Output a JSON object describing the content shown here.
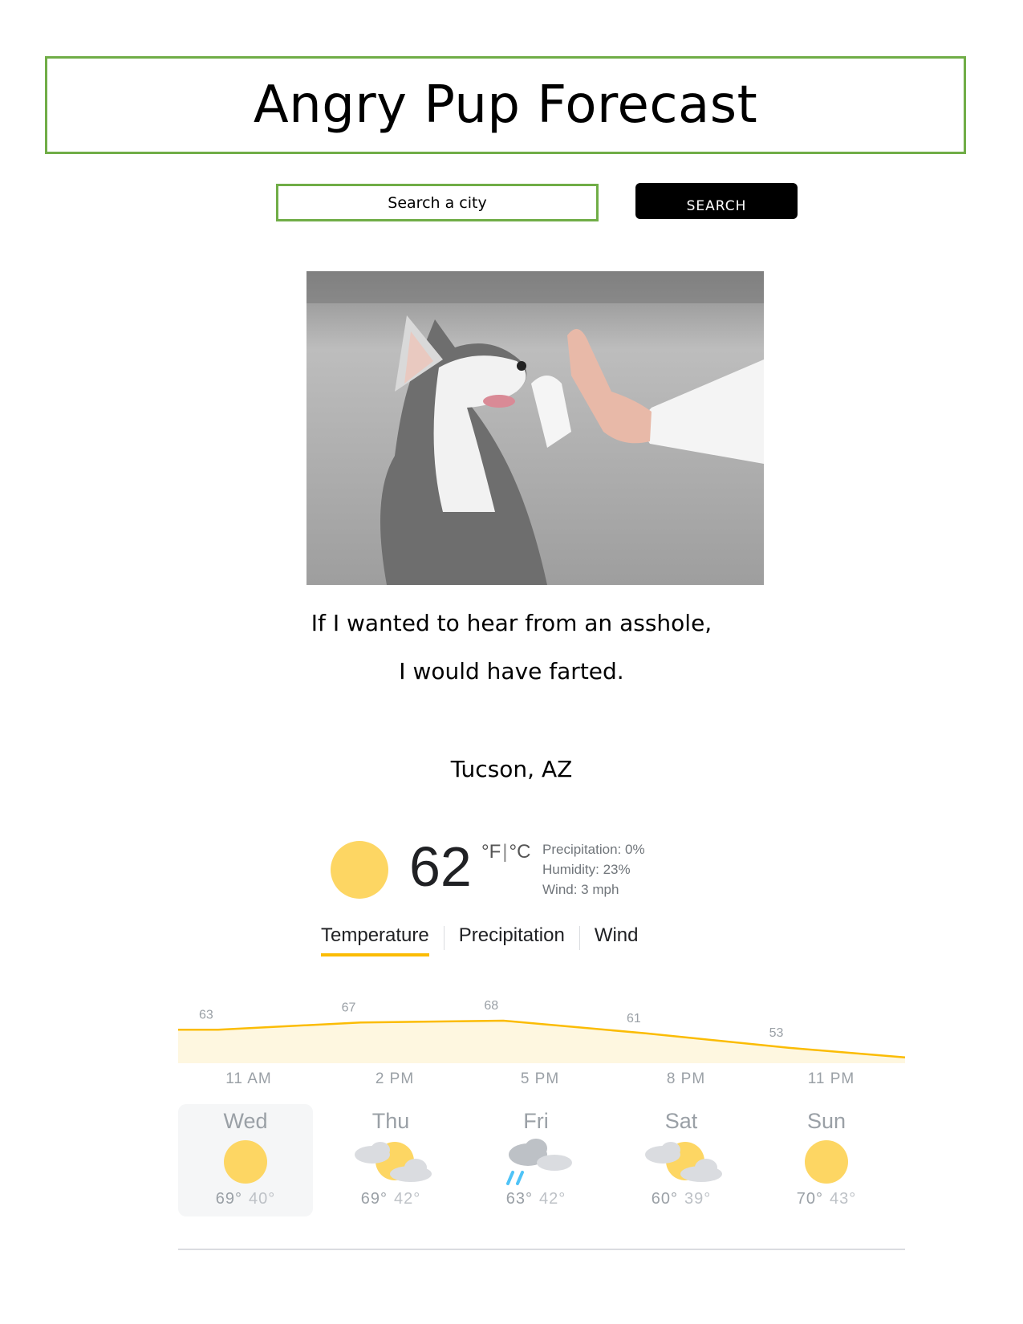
{
  "header": {
    "title": "Angry Pup Forecast"
  },
  "search": {
    "placeholder": "Search a city",
    "button_label": "SEARCH"
  },
  "quote": {
    "line1": "If I wanted to hear from an asshole,",
    "line2": "I would have farted."
  },
  "location": {
    "city": "Tucson, AZ"
  },
  "current": {
    "temperature": "62",
    "unit_f": "°F",
    "unit_sep": "|",
    "unit_c": "°C",
    "precipitation": "Precipitation: 0%",
    "humidity": "Humidity: 23%",
    "wind": "Wind: 3 mph",
    "icon": "sun-icon"
  },
  "tabs": [
    {
      "label": "Temperature",
      "active": true
    },
    {
      "label": "Precipitation",
      "active": false
    },
    {
      "label": "Wind",
      "active": false
    }
  ],
  "colors": {
    "accent": "#fbbc04",
    "sun": "#fdd663",
    "border": "#70ad47",
    "chart_fill": "#fef7e0",
    "chart_line": "#fbbc04"
  },
  "chart_data": {
    "type": "area",
    "x": [
      "11 AM",
      "2 PM",
      "5 PM",
      "8 PM",
      "11 PM"
    ],
    "series": [
      {
        "values": [
          63,
          67,
          68,
          61,
          53
        ]
      }
    ],
    "ylim": [
      0,
      75
    ],
    "grid": false
  },
  "forecast": [
    {
      "day": "Wed",
      "high": "69°",
      "low": "40°",
      "icon": "sun-icon",
      "selected": true
    },
    {
      "day": "Thu",
      "high": "69°",
      "low": "42°",
      "icon": "partly-cloudy-icon",
      "selected": false
    },
    {
      "day": "Fri",
      "high": "63°",
      "low": "42°",
      "icon": "rain-cloud-icon",
      "selected": false
    },
    {
      "day": "Sat",
      "high": "60°",
      "low": "39°",
      "icon": "partly-cloudy-icon",
      "selected": false
    },
    {
      "day": "Sun",
      "high": "70°",
      "low": "43°",
      "icon": "sun-icon",
      "selected": false
    }
  ]
}
